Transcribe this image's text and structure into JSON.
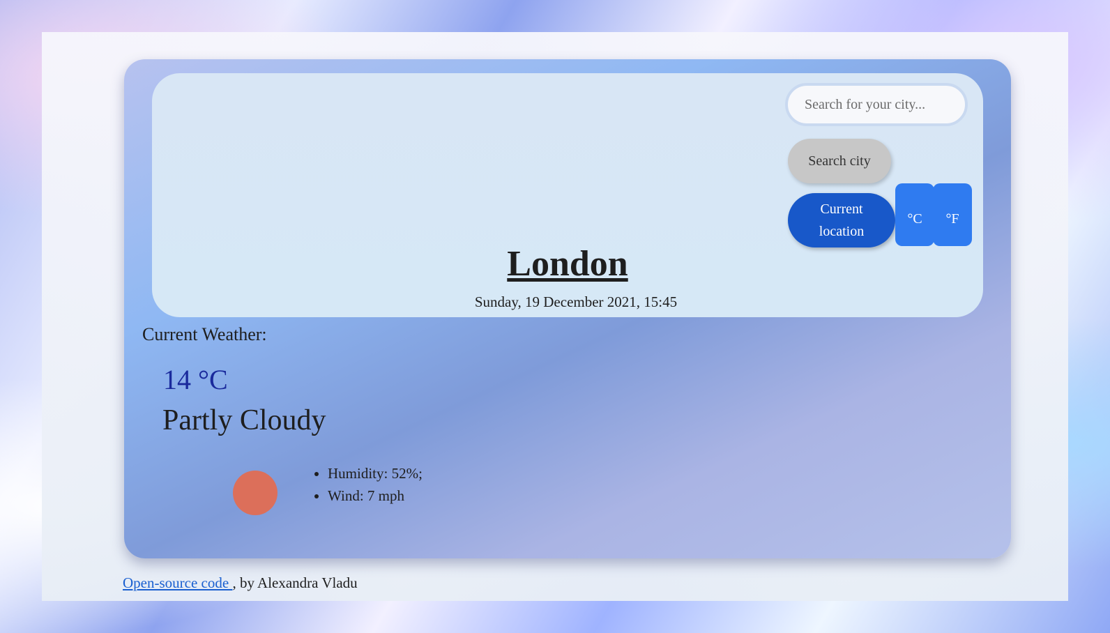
{
  "search": {
    "placeholder": "Search for your city..."
  },
  "buttons": {
    "search_city": "Search city",
    "current_location_line1": "Current",
    "current_location_line2": "location",
    "celsius": "°C",
    "fahrenheit": "°F"
  },
  "location": {
    "city": "London",
    "datetime": "Sunday, 19 December 2021, 15:45"
  },
  "weather": {
    "section_label": "Current Weather:",
    "temperature": "14 °C",
    "condition": "Partly Cloudy",
    "icon": "sun-icon",
    "details": [
      "Humidity: 52%;",
      "Wind: 7 mph"
    ]
  },
  "footer": {
    "link_text": "Open-source code ",
    "author_text": ", by Alexandra Vladu"
  },
  "colors": {
    "primary_button": "#1858c9",
    "unit_button": "#2f7bf0",
    "temperature_text": "#1a2a9c",
    "sun_icon": "#dc6f5a"
  }
}
